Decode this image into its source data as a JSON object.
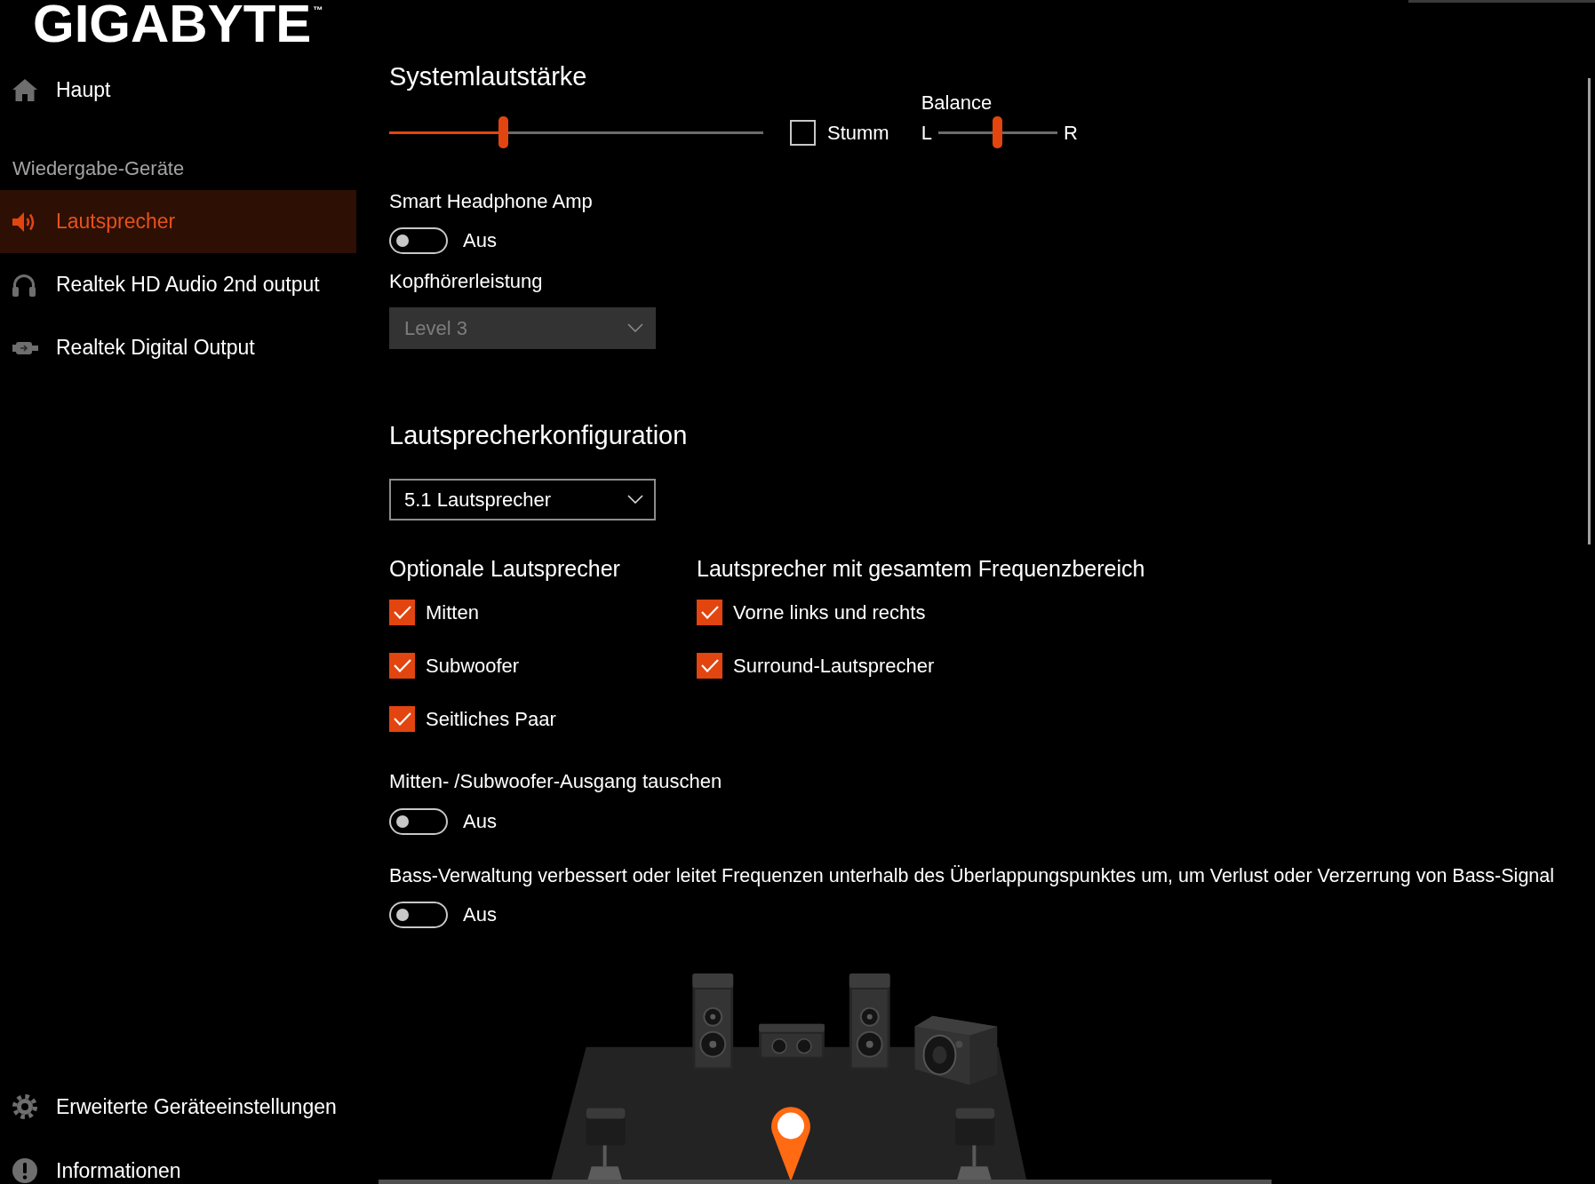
{
  "logo": {
    "text": "GIGABYTE$^{™}$"
  },
  "sidebar": {
    "main_items": [
      {
        "label": "Haupt",
        "selected": false
      }
    ],
    "section_title": "Wiedergabe-Geräte",
    "devices": [
      {
        "label": "Lautsprecher",
        "selected": true
      },
      {
        "label": "Realtek HD Audio 2nd output",
        "selected": false
      },
      {
        "label": "Realtek Digital Output",
        "selected": false
      }
    ],
    "bottom_items": [
      {
        "label": "Erweiterte Geräteeinstellungen",
        "selected": false
      },
      {
        "label": "Informationen",
        "selected": false
      }
    ]
  },
  "system_volume": {
    "title": "Systemlautstärke",
    "level": 0.3,
    "mute": {
      "label": "Stumm",
      "checked": false
    },
    "balance": {
      "label": "Balance",
      "left": "L",
      "right": "R",
      "level": 0.5
    }
  },
  "smart_headphone_amp": {
    "title": "Smart Headphone Amp",
    "on": false,
    "state_label": "Aus"
  },
  "headphone_power": {
    "title": "Kopfhörerleistung",
    "value": "Level 3",
    "disabled": true
  },
  "speaker_config": {
    "title": "Lautsprecherkonfiguration",
    "value": "5.1 Lautsprecher",
    "disabled": false
  },
  "optional_speakers": {
    "title": "Optionale Lautsprecher",
    "items": [
      {
        "label": "Mitten",
        "checked": true
      },
      {
        "label": "Subwoofer",
        "checked": true
      },
      {
        "label": "Seitliches Paar",
        "checked": true
      }
    ]
  },
  "full_range_speakers": {
    "title": "Lautsprecher mit gesamtem Frequenzbereich",
    "items": [
      {
        "label": "Vorne links und rechts",
        "checked": true
      },
      {
        "label": "Surround-Lautsprecher",
        "checked": true
      }
    ]
  },
  "swap_center_subwoofer": {
    "title": "Mitten- /Subwoofer-Ausgang tauschen",
    "on": false,
    "state_label": "Aus"
  },
  "bass_management": {
    "title": "Bass-Verwaltung verbessert oder leitet Frequenzen unterhalb des Überlappungspunktes um, um Verlust oder Verzerrung von Bass-Signal",
    "on": false,
    "state_label": "Aus"
  }
}
